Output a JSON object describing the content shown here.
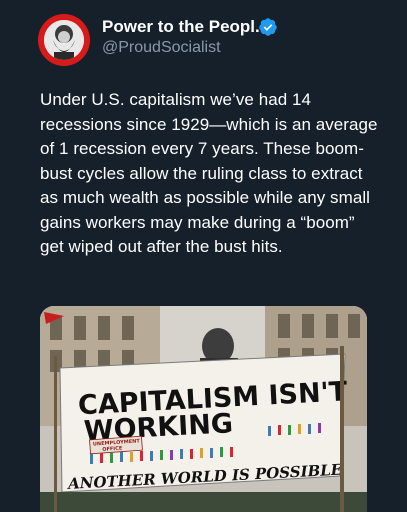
{
  "author": {
    "display_name": "Power to the Peopl...",
    "handle": "@ProudSocialist",
    "avatar_icon": "karl-marx-portrait-avatar",
    "verified_icon": "verified-badge-icon",
    "verified_color": "#1d9bf0",
    "avatar_ring_color": "#d81a1a"
  },
  "tweet": {
    "text": "Under U.S. capitalism we’ve had 14 recessions since 1929—which is an average of 1 recession every 7 years. These boom-bust cycles allow the ruling class to extract as much wealth as possible while any small gains workers may make during a “boom” get wiped out after the bust hits."
  },
  "media": {
    "banner_line1": "CAPITALISM ISN'T",
    "banner_line2": "WORKING",
    "banner_bottom": "ANOTHER WORLD IS POSSIBLE",
    "sign_line1": "UNEMPLOYMENT",
    "sign_line2": "OFFICE"
  },
  "theme": {
    "background": "#15202b",
    "text": "#ffffff",
    "muted": "#8b98a5"
  }
}
